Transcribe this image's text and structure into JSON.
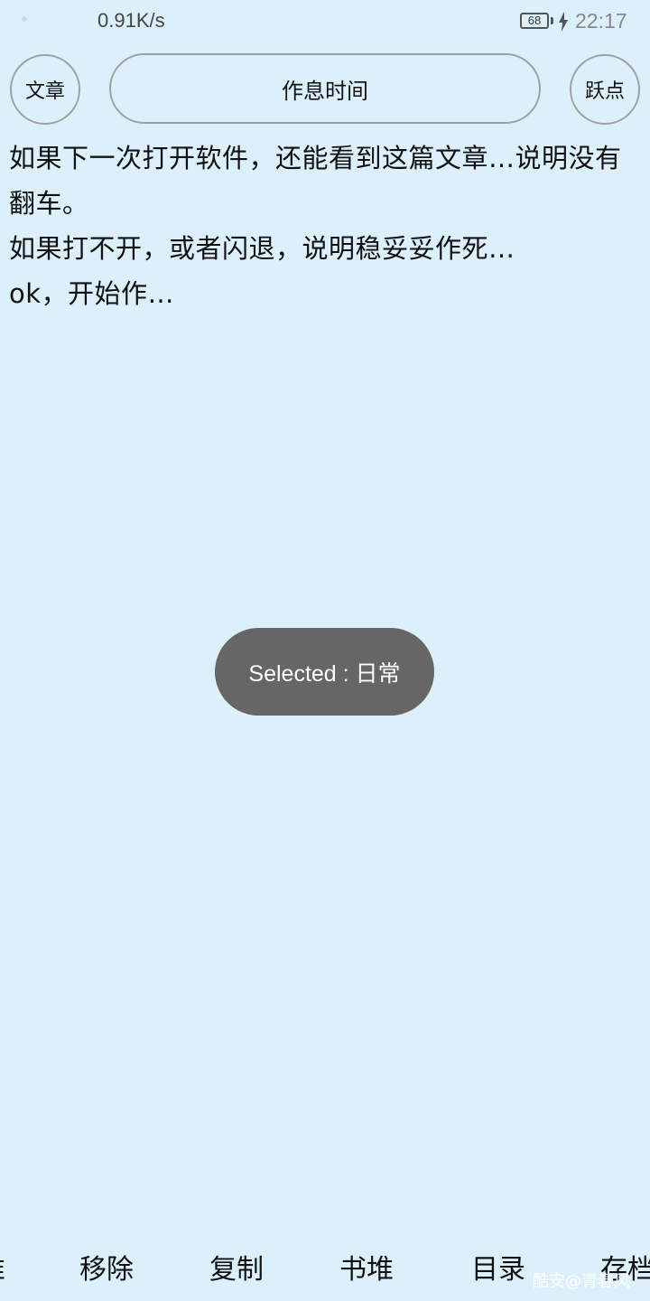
{
  "status_bar": {
    "net_speed": "0.91K/s",
    "battery_level": "68",
    "charging_icon": "lightning-icon",
    "time": "22:17"
  },
  "header": {
    "article_button_label": "文章",
    "title": "作息时间",
    "jump_button_label": "跃点"
  },
  "content": {
    "lines": [
      "如果下一次打开软件，还能看到这篇文章…说明没有翻车。",
      "如果打不开，或者闪退，说明稳妥妥作死…",
      "ok，开始作…"
    ]
  },
  "toast": {
    "text": "Selected : 日常"
  },
  "bottom_bar": {
    "items": [
      "堆",
      "移除",
      "复制",
      "书堆",
      "目录",
      "存档"
    ]
  },
  "watermark": "酷安@青春风",
  "colors": {
    "background": "#dcf0fc",
    "toast_background": "#666666",
    "border": "#a0a0a0"
  }
}
